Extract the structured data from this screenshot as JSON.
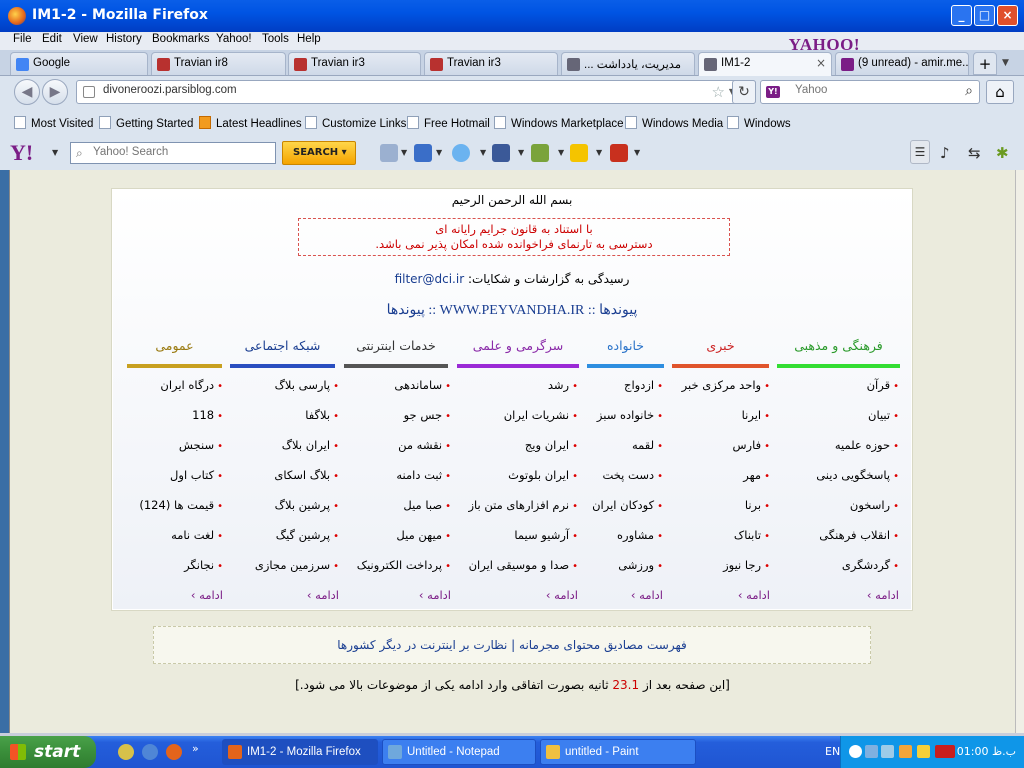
{
  "window": {
    "title": "IM1-2 - Mozilla Firefox",
    "min": "_",
    "max": "□",
    "close": "×"
  },
  "menu": [
    "File",
    "Edit",
    "View",
    "History",
    "Bookmarks",
    "Yahoo!",
    "Tools",
    "Help"
  ],
  "yahoo_brand": "YAHOO!",
  "tabs": [
    {
      "label": "Google",
      "icon": "google-icon",
      "color": "#4285f4"
    },
    {
      "label": "Travian ir8",
      "icon": "travian-icon",
      "color": "#b8312f"
    },
    {
      "label": "Travian ir3",
      "icon": "travian-icon",
      "color": "#b8312f"
    },
    {
      "label": "Travian ir3",
      "icon": "travian-icon",
      "color": "#b8312f"
    },
    {
      "label": "... مدیریت، یادداشت",
      "icon": "parsiblog-icon",
      "color": "#667"
    },
    {
      "label": "IM1-2",
      "icon": "parsiblog-icon",
      "color": "#667",
      "active": true
    },
    {
      "label": "(9 unread) - amir.me...",
      "icon": "yahoo-mail-icon",
      "color": "#7b1d86"
    }
  ],
  "newtab": "+",
  "url": "divoneroozi.parsiblog.com",
  "search_placeholder": "Yahoo",
  "bookmarks": [
    "Most Visited",
    "Getting Started",
    "Latest Headlines",
    "Customize Links",
    "Free Hotmail",
    "Windows Marketplace",
    "Windows Media",
    "Windows"
  ],
  "ytoolbar": {
    "logo": "Y!",
    "placeholder": "Yahoo! Search",
    "button": "SEARCH"
  },
  "page": {
    "bismillah": "بسم الله الرحمن الرحیم",
    "notice_line1": "با استناد به قانون جرایم رایانه ای",
    "notice_line2": "دسترسی به تارنمای فراخوانده شده امکان پذیر نمی باشد.",
    "report_text": "رسیدگی به گزارشات و شکایات:",
    "report_email": "filter@dci.ir",
    "heading": "پیوندها :: WWW.PEYVANDHA.IR :: پیوندها",
    "categories": [
      {
        "label": "فرهنگی و مذهبی",
        "color": "#2a9a2a",
        "bar": "#33dd33",
        "items": [
          "قرآن",
          "تبیان",
          "حوزه علمیه",
          "پاسخگویی دینی",
          "راسخون",
          "انقلاب فرهنگی",
          "گردشگری"
        ]
      },
      {
        "label": "خبری",
        "color": "#cc2222",
        "bar": "#e0542c",
        "items": [
          "واحد مرکزی خبر",
          "ایرنا",
          "فارس",
          "مهر",
          "برنا",
          "تابناک",
          "رجا نیوز"
        ]
      },
      {
        "label": "خانواده",
        "color": "#2a73c9",
        "bar": "#2e8ee0",
        "items": [
          "ازدواج",
          "خانواده سبز",
          "لقمه",
          "دست پخت",
          "کودکان ایران",
          "مشاوره",
          "ورزشی"
        ]
      },
      {
        "label": "سرگرمی و علمی",
        "color": "#8a2aa8",
        "bar": "#9b2ad6",
        "items": [
          "رشد",
          "نشریات ایران",
          "ایران ویج",
          "ایران بلوتوث",
          "نرم افزارهای متن باز",
          "آرشیو سیما",
          "صدا و موسیقی ایران"
        ]
      },
      {
        "label": "خدمات اینترنتی",
        "color": "#333333",
        "bar": "#555555",
        "items": [
          "ساماندهی",
          "جس جو",
          "نقشه من",
          "ثبت دامنه",
          "صبا میل",
          "میهن میل",
          "پرداخت الکترونیک"
        ]
      },
      {
        "label": "شبکه اجتماعی",
        "color": "#1a3e91",
        "bar": "#2a4ec0",
        "items": [
          "پارسی بلاگ",
          "بلاگفا",
          "ایران بلاگ",
          "بلاگ اسکای",
          "پرشین بلاگ",
          "پرشین گیگ",
          "سرزمین مجازی"
        ]
      },
      {
        "label": "عمومی",
        "color": "#9a7a10",
        "bar": "#c8a020",
        "items": [
          "درگاه ایران",
          "118",
          "سنجش",
          "کتاب اول",
          "قیمت ها (124)",
          "لغت نامه",
          "نجانگر"
        ]
      }
    ],
    "more": "ادامه",
    "links_line": "فهرست مصادیق محتوای مجرمانه | نظارت بر اینترنت در دیگر کشورها",
    "countdown_prefix": "[این صفحه بعد از",
    "countdown_value": "23.1",
    "countdown_suffix": "ثانیه بصورت اتفاقی وارد ادامه یکی از موضوعات بالا می شود.]"
  },
  "taskbar": {
    "start": "start",
    "tasks": [
      {
        "label": "IM1-2 - Mozilla Firefox",
        "color": "#e4641b",
        "active": true
      },
      {
        "label": "Untitled - Notepad",
        "color": "#6fa8dc"
      },
      {
        "label": "untitled - Paint",
        "color": "#f0c040"
      }
    ],
    "lang": "EN",
    "clock": "01:00 ب.ظ"
  }
}
